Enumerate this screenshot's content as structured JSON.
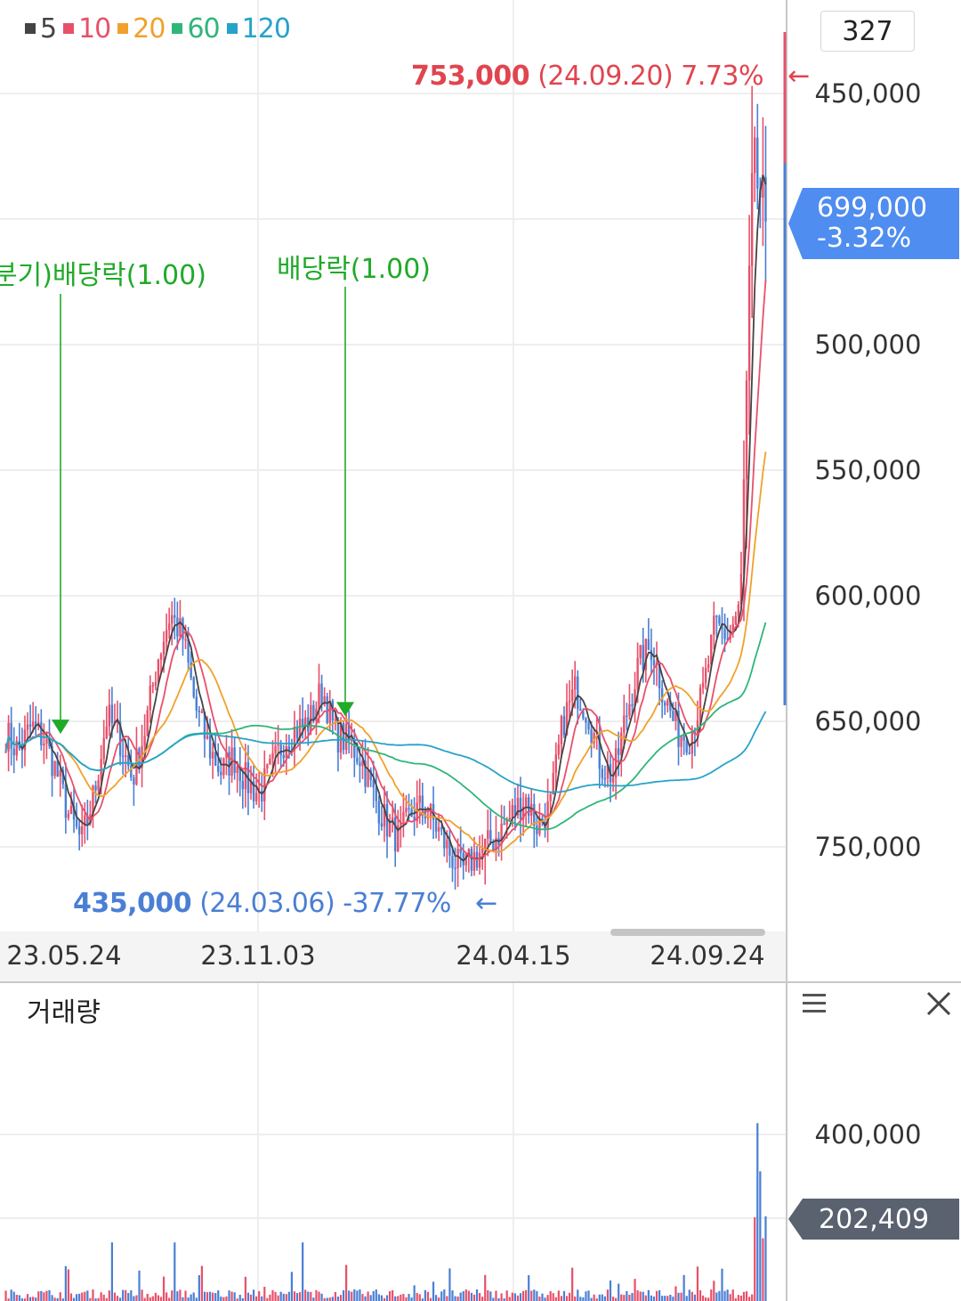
{
  "legend": [
    {
      "label": "5",
      "color": "#444444"
    },
    {
      "label": "10",
      "color": "#e8506a"
    },
    {
      "label": "20",
      "color": "#f0a12b"
    },
    {
      "label": "60",
      "color": "#30b57a"
    },
    {
      "label": "120",
      "color": "#27a3c9"
    }
  ],
  "badge": "327",
  "price_axis": [
    "750,000",
    "650,000",
    "600,000",
    "550,000",
    "500,000",
    "450,000"
  ],
  "date_axis": [
    "23.05.24",
    "23.11.03",
    "24.04.15",
    "24.09.24"
  ],
  "current_price": {
    "value": "699,000",
    "change": "-3.32%",
    "color": "#4f8df0"
  },
  "high_marker": {
    "value": "753,000",
    "detail": "(24.09.20) 7.73%",
    "arrow": "←",
    "color": "#e0454f"
  },
  "low_marker": {
    "value": "435,000",
    "detail": "(24.03.06) -37.77%",
    "arrow": "←",
    "color": "#4a7fd4"
  },
  "events": [
    {
      "label": "분기)배당락(1.00)",
      "color": "#1faa28"
    },
    {
      "label": "배당락(1.00)",
      "color": "#1faa28"
    }
  ],
  "volume_panel": {
    "title": "거래량",
    "axis_label": "400,000",
    "current_volume": "202,409",
    "menu_icon": "menu-icon",
    "close_icon": "close-icon"
  },
  "chart_data": [
    {
      "type": "candlestick",
      "title": "",
      "x": [
        "23.05.24",
        "23.11.03",
        "24.04.15",
        "24.09.24"
      ],
      "ylim": [
        410000,
        775000
      ],
      "y_ticks": [
        450000,
        500000,
        550000,
        600000,
        650000,
        750000
      ],
      "up_color": "#e8506a",
      "down_color": "#4a7fd4",
      "close_path": [
        495000,
        488000,
        498000,
        493000,
        480000,
        462000,
        452000,
        472000,
        502000,
        493000,
        477000,
        497000,
        525000,
        543000,
        533000,
        505000,
        490000,
        480000,
        486000,
        476000,
        471000,
        481000,
        493000,
        497000,
        500000,
        513000,
        495000,
        492000,
        486000,
        471000,
        460000,
        453000,
        463000,
        466000,
        458000,
        448000,
        440000,
        446000,
        450000,
        456000,
        463000,
        470000,
        458000,
        466000,
        500000,
        513000,
        503000,
        483000,
        478000,
        503000,
        523000,
        530000,
        510000,
        496000,
        494000,
        510000,
        538000,
        534000,
        545000,
        722000,
        699000
      ],
      "moving_averages": [
        {
          "name": "5",
          "color": "#444444"
        },
        {
          "name": "10",
          "color": "#e8506a"
        },
        {
          "name": "20",
          "color": "#f0a12b"
        },
        {
          "name": "60",
          "color": "#30b57a"
        },
        {
          "name": "120",
          "color": "#27a3c9"
        }
      ],
      "high": {
        "value": 753000,
        "date": "24.09.20",
        "pct": "7.73%"
      },
      "low": {
        "value": 435000,
        "date": "24.03.06",
        "pct": "-37.77%"
      },
      "last_close": 699000,
      "events": [
        {
          "label": "분기)배당락(1.00)",
          "value": 495000
        },
        {
          "label": "배당락(1.00)",
          "value": 502000
        }
      ],
      "grid": true
    },
    {
      "type": "bar",
      "title": "거래량",
      "ylim": [
        0,
        450000
      ],
      "y_ticks": [
        400000
      ],
      "last_volume": 202409,
      "peak_volume": 425000,
      "grid": true
    }
  ]
}
